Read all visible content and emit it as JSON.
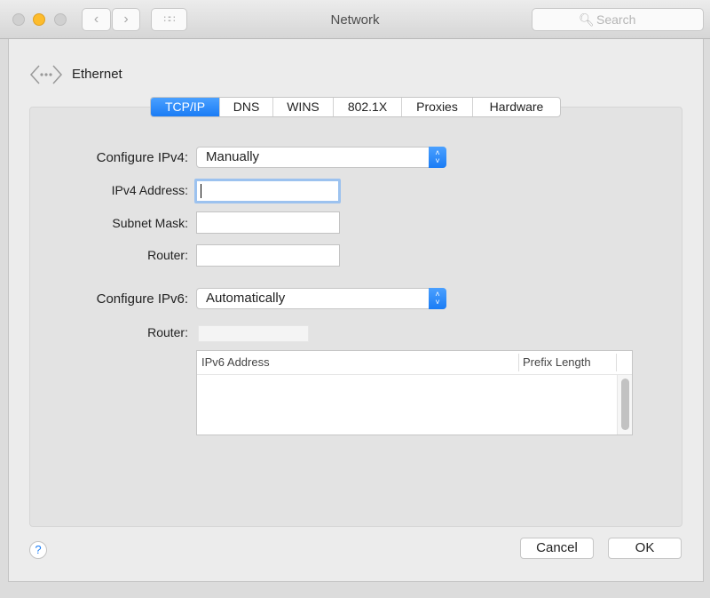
{
  "window": {
    "title": "Network",
    "search_placeholder": "Search"
  },
  "header": {
    "interface": "Ethernet"
  },
  "tabs": [
    {
      "label": "TCP/IP",
      "selected": true
    },
    {
      "label": "DNS"
    },
    {
      "label": "WINS"
    },
    {
      "label": "802.1X"
    },
    {
      "label": "Proxies"
    },
    {
      "label": "Hardware"
    }
  ],
  "form": {
    "configure_ipv4_label": "Configure IPv4:",
    "configure_ipv4_value": "Manually",
    "ipv4_address_label": "IPv4 Address:",
    "ipv4_address_value": "",
    "subnet_mask_label": "Subnet Mask:",
    "subnet_mask_value": "",
    "router_label": "Router:",
    "router_value": "",
    "configure_ipv6_label": "Configure IPv6:",
    "configure_ipv6_value": "Automatically",
    "ipv6_router_label": "Router:",
    "ipv6_router_value": ""
  },
  "ipv6_table": {
    "columns": [
      "IPv6 Address",
      "Prefix Length"
    ],
    "rows": []
  },
  "footer": {
    "help": "?",
    "cancel": "Cancel",
    "ok": "OK"
  },
  "colors": {
    "accent": "#1a7cf5",
    "minimize": "#fdbc2c"
  }
}
